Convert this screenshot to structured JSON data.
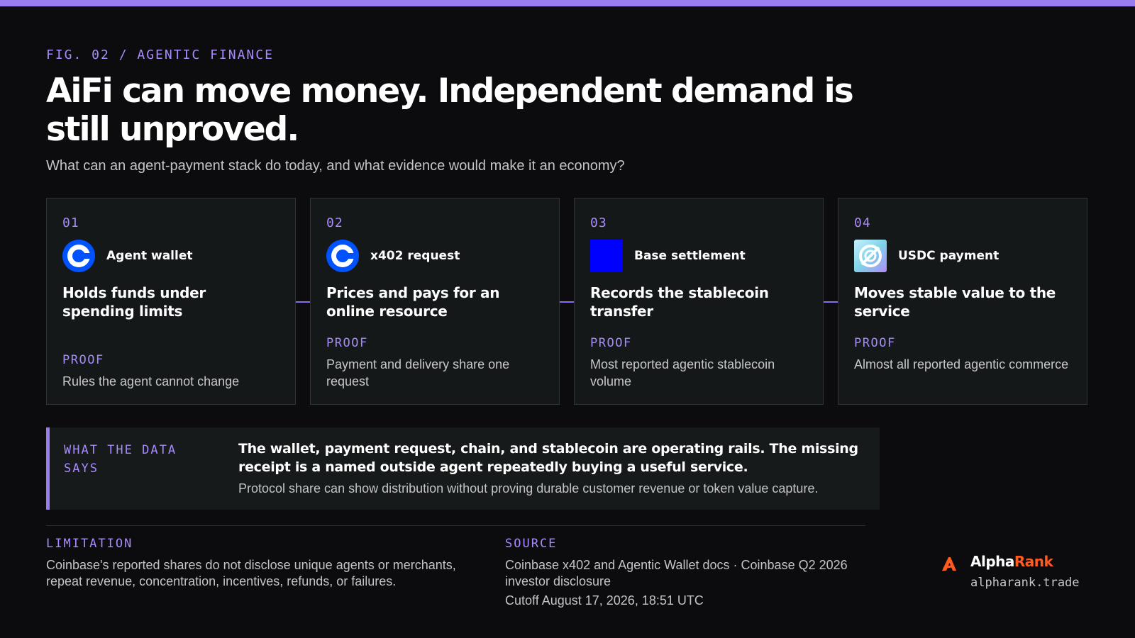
{
  "header": {
    "eyebrow": "FIG. 02 / AGENTIC FINANCE",
    "title": "AiFi can move money. Independent demand is still unproved.",
    "subtitle": "What can an agent-payment stack do today, and what evidence would make it an economy?"
  },
  "cards": [
    {
      "num": "01",
      "logo": "coinbase-icon",
      "label": "Agent wallet",
      "claim": "Holds funds under spending limits",
      "proof_label": "PROOF",
      "proof": "Rules the agent cannot change"
    },
    {
      "num": "02",
      "logo": "coinbase-icon",
      "label": "x402 request",
      "claim": "Prices and pays for an online resource",
      "proof_label": "PROOF",
      "proof": "Payment and delivery share one request"
    },
    {
      "num": "03",
      "logo": "base-icon",
      "label": "Base settlement",
      "claim": "Records the stablecoin transfer",
      "proof_label": "PROOF",
      "proof": "Most reported agentic stablecoin volume"
    },
    {
      "num": "04",
      "logo": "usdc-icon",
      "label": "USDC payment",
      "claim": "Moves stable value to the service",
      "proof_label": "PROOF",
      "proof": "Almost all reported agentic commerce"
    }
  ],
  "callout": {
    "label": "WHAT THE DATA SAYS",
    "headline": "The wallet, payment request, chain, and stablecoin are operating rails. The missing receipt is a named outside agent repeatedly buying a useful service.",
    "body": "Protocol share can show distribution without proving durable customer revenue or token value capture."
  },
  "footer": {
    "limitation_label": "LIMITATION",
    "limitation": "Coinbase's reported shares do not disclose unique agents or merchants, repeat revenue, concentration, incentives, refunds, or failures.",
    "source_label": "SOURCE",
    "source": "Coinbase x402 and Agentic Wallet docs · Coinbase Q2 2026 investor disclosure",
    "cutoff": "Cutoff August 17, 2026, 18:51 UTC"
  },
  "brand": {
    "name_alpha": "Alpha",
    "name_rank": "Rank",
    "url": "alpharank.trade",
    "logo": "alpharank-logo-icon"
  },
  "colors": {
    "accent": "#9b7cf0",
    "accent_text": "#a78bfa",
    "background": "#0c0c0e",
    "card": "#141819",
    "coinbase_blue": "#0052ff",
    "base_blue": "#0000ff",
    "brand_orange": "#ff5a1f"
  }
}
